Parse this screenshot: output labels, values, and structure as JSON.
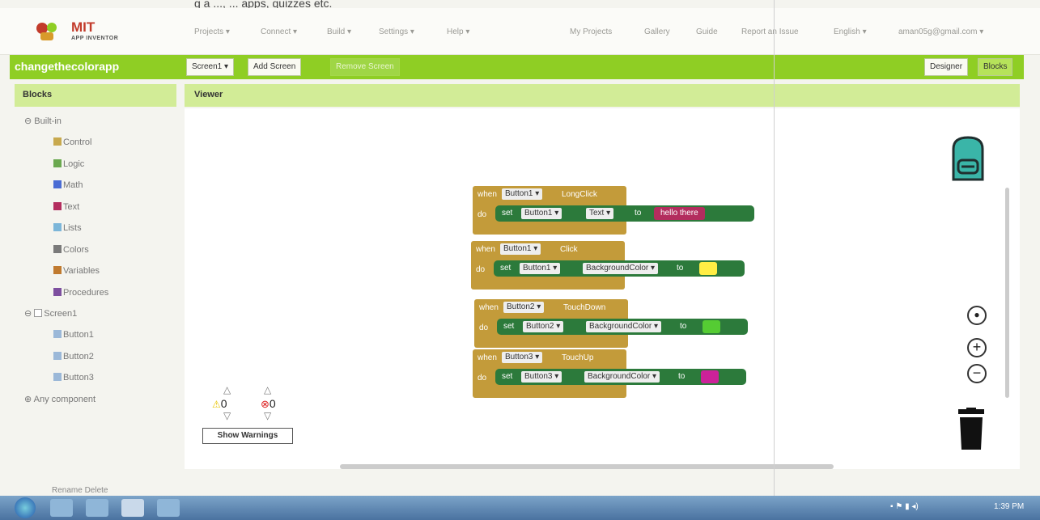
{
  "clipped_text": "g a ..., ... apps, quizzes etc.",
  "logo": {
    "name": "MIT",
    "sub": "APP INVENTOR"
  },
  "menu": {
    "left": [
      "Projects ▾",
      "Connect ▾",
      "Build ▾",
      "Settings ▾",
      "Help ▾"
    ],
    "right": [
      "My Projects",
      "Gallery",
      "Guide",
      "Report an Issue",
      "English ▾",
      "aman05g@gmail.com ▾"
    ]
  },
  "appbar": {
    "name": "changethecolorapp",
    "screen": "Screen1 ▾",
    "add_screen": "Add Screen",
    "remove_screen": "Remove Screen",
    "designer": "Designer",
    "blocks": "Blocks"
  },
  "panels": {
    "blocks": "Blocks",
    "viewer": "Viewer"
  },
  "tree": {
    "builtin": "Built-in",
    "builtin_items": [
      {
        "label": "Control",
        "color": "#c8a94e"
      },
      {
        "label": "Logic",
        "color": "#6aa84f"
      },
      {
        "label": "Math",
        "color": "#4a6cd4"
      },
      {
        "label": "Text",
        "color": "#b32d5e"
      },
      {
        "label": "Lists",
        "color": "#7cb6d9"
      },
      {
        "label": "Colors",
        "color": "#7a7a7a"
      },
      {
        "label": "Variables",
        "color": "#c07a2f"
      },
      {
        "label": "Procedures",
        "color": "#7d4f9f"
      }
    ],
    "screen": "Screen1",
    "components": [
      "Button1",
      "Button2",
      "Button3"
    ],
    "any": "Any component"
  },
  "blocks": [
    {
      "when": "when",
      "component": "Button1 ▾",
      "event": "LongClick",
      "do": "do",
      "set": "set",
      "target": "Button1 ▾",
      "prop": "Text ▾",
      "to": "to",
      "value": "hello there",
      "value_color": "#b32d5e"
    },
    {
      "when": "when",
      "component": "Button1 ▾",
      "event": "Click",
      "do": "do",
      "set": "set",
      "target": "Button1 ▾",
      "prop": "BackgroundColor ▾",
      "to": "to",
      "value": "",
      "value_color": "#ffee44"
    },
    {
      "when": "when",
      "component": "Button2 ▾",
      "event": "TouchDown",
      "do": "do",
      "set": "set",
      "target": "Button2 ▾",
      "prop": "BackgroundColor ▾",
      "to": "to",
      "value": "",
      "value_color": "#55cc33"
    },
    {
      "when": "when",
      "component": "Button3 ▾",
      "event": "TouchUp",
      "do": "do",
      "set": "set",
      "target": "Button3 ▾",
      "prop": "BackgroundColor ▾",
      "to": "to",
      "value": "",
      "value_color": "#cc2299"
    }
  ],
  "warnings": {
    "warn_count": "0",
    "error_count": "0",
    "button": "Show Warnings"
  },
  "bottom_links": "Rename   Delete",
  "taskbar": {
    "time": "1:39 PM"
  },
  "colors": {
    "accent": "#8fce24",
    "event_block": "#c39b3a",
    "set_block": "#2c7a3b"
  }
}
